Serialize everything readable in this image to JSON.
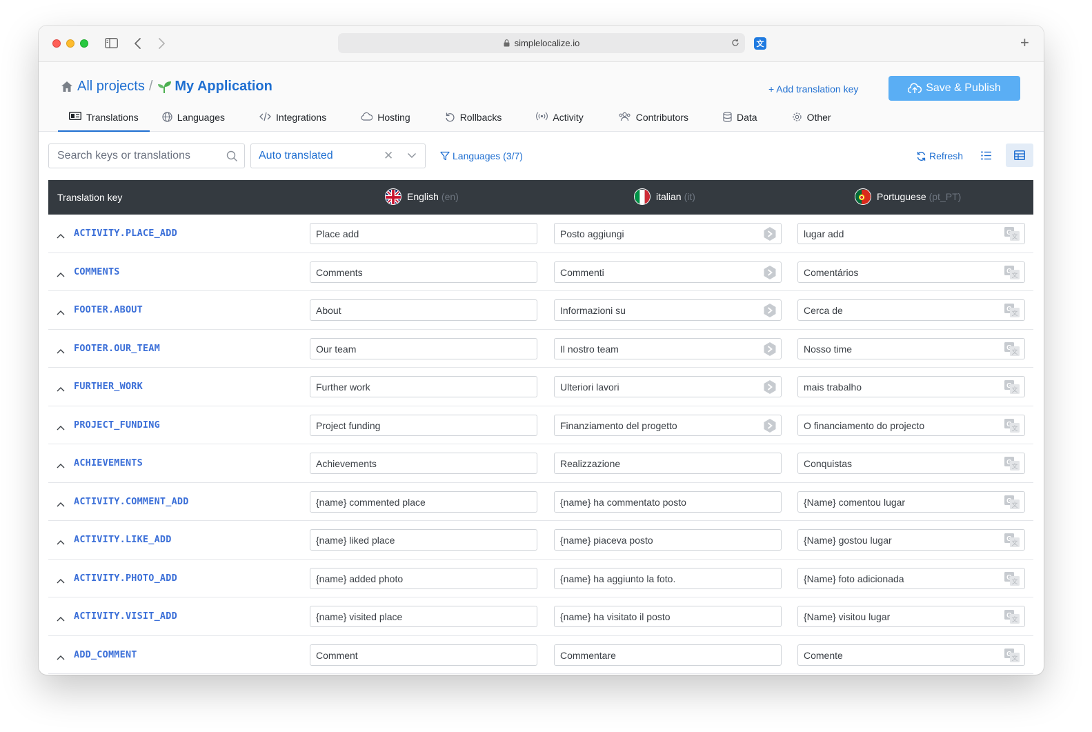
{
  "browser": {
    "url": "simplelocalize.io"
  },
  "breadcrumb": {
    "root": "All projects",
    "separator": "/",
    "current": "My Application"
  },
  "header": {
    "add_key_label": "+ Add translation key",
    "save_label": "Save & Publish"
  },
  "tabs": [
    {
      "label": "Translations",
      "icon": "translations-icon",
      "active": true
    },
    {
      "label": "Languages",
      "icon": "globe-icon"
    },
    {
      "label": "Integrations",
      "icon": "code-icon"
    },
    {
      "label": "Hosting",
      "icon": "cloud-icon"
    },
    {
      "label": "Rollbacks",
      "icon": "undo-icon"
    },
    {
      "label": "Activity",
      "icon": "broadcast-icon"
    },
    {
      "label": "Contributors",
      "icon": "users-icon"
    },
    {
      "label": "Data",
      "icon": "database-icon"
    },
    {
      "label": "Other",
      "icon": "gear-icon"
    }
  ],
  "toolbar": {
    "search_placeholder": "Search keys or translations",
    "filter_value": "Auto translated",
    "languages_filter": "Languages (3/7)",
    "refresh_label": "Refresh"
  },
  "table": {
    "key_header": "Translation key",
    "languages": [
      {
        "name": "English",
        "code": "(en)"
      },
      {
        "name": "italian",
        "code": "(it)"
      },
      {
        "name": "Portuguese",
        "code": "(pt_PT)"
      }
    ],
    "rows": [
      {
        "key": "ACTIVITY.PLACE_ADD",
        "en": "Place add",
        "it": "Posto aggiungi",
        "pt": "lugar add"
      },
      {
        "key": "COMMENTS",
        "en": "Comments",
        "it": "Commenti",
        "pt": "Comentários"
      },
      {
        "key": "FOOTER.ABOUT",
        "en": "About",
        "it": "Informazioni su",
        "pt": "Cerca de"
      },
      {
        "key": "FOOTER.OUR_TEAM",
        "en": "Our team",
        "it": "Il nostro team",
        "pt": "Nosso time"
      },
      {
        "key": "FURTHER_WORK",
        "en": "Further work",
        "it": "Ulteriori lavori",
        "pt": "mais trabalho"
      },
      {
        "key": "PROJECT_FUNDING",
        "en": "Project funding",
        "it": "Finanziamento del progetto",
        "pt": "O financiamento do projecto"
      },
      {
        "key": "ACHIEVEMENTS",
        "en": "Achievements",
        "it": "Realizzazione",
        "pt": "Conquistas"
      },
      {
        "key": "ACTIVITY.COMMENT_ADD",
        "en": "{name} commented place",
        "it": "{name} ha commentato posto",
        "pt": "{Name} comentou lugar"
      },
      {
        "key": "ACTIVITY.LIKE_ADD",
        "en": "{name} liked place",
        "it": "{name} piaceva posto",
        "pt": "{Name} gostou lugar"
      },
      {
        "key": "ACTIVITY.PHOTO_ADD",
        "en": "{name} added photo",
        "it": "{name} ha aggiunto la foto.",
        "pt": "{Name} foto adicionada"
      },
      {
        "key": "ACTIVITY.VISIT_ADD",
        "en": "{name} visited place",
        "it": "{name} ha visitato il posto",
        "pt": "{Name} visitou lugar"
      },
      {
        "key": "ADD_COMMENT",
        "en": "Comment",
        "it": "Commentare",
        "pt": "Comente"
      }
    ]
  },
  "colors": {
    "accent": "#1f6fd1",
    "save_button": "#5aaef4",
    "table_header": "#343a40",
    "key_text": "#3b6fd8"
  }
}
